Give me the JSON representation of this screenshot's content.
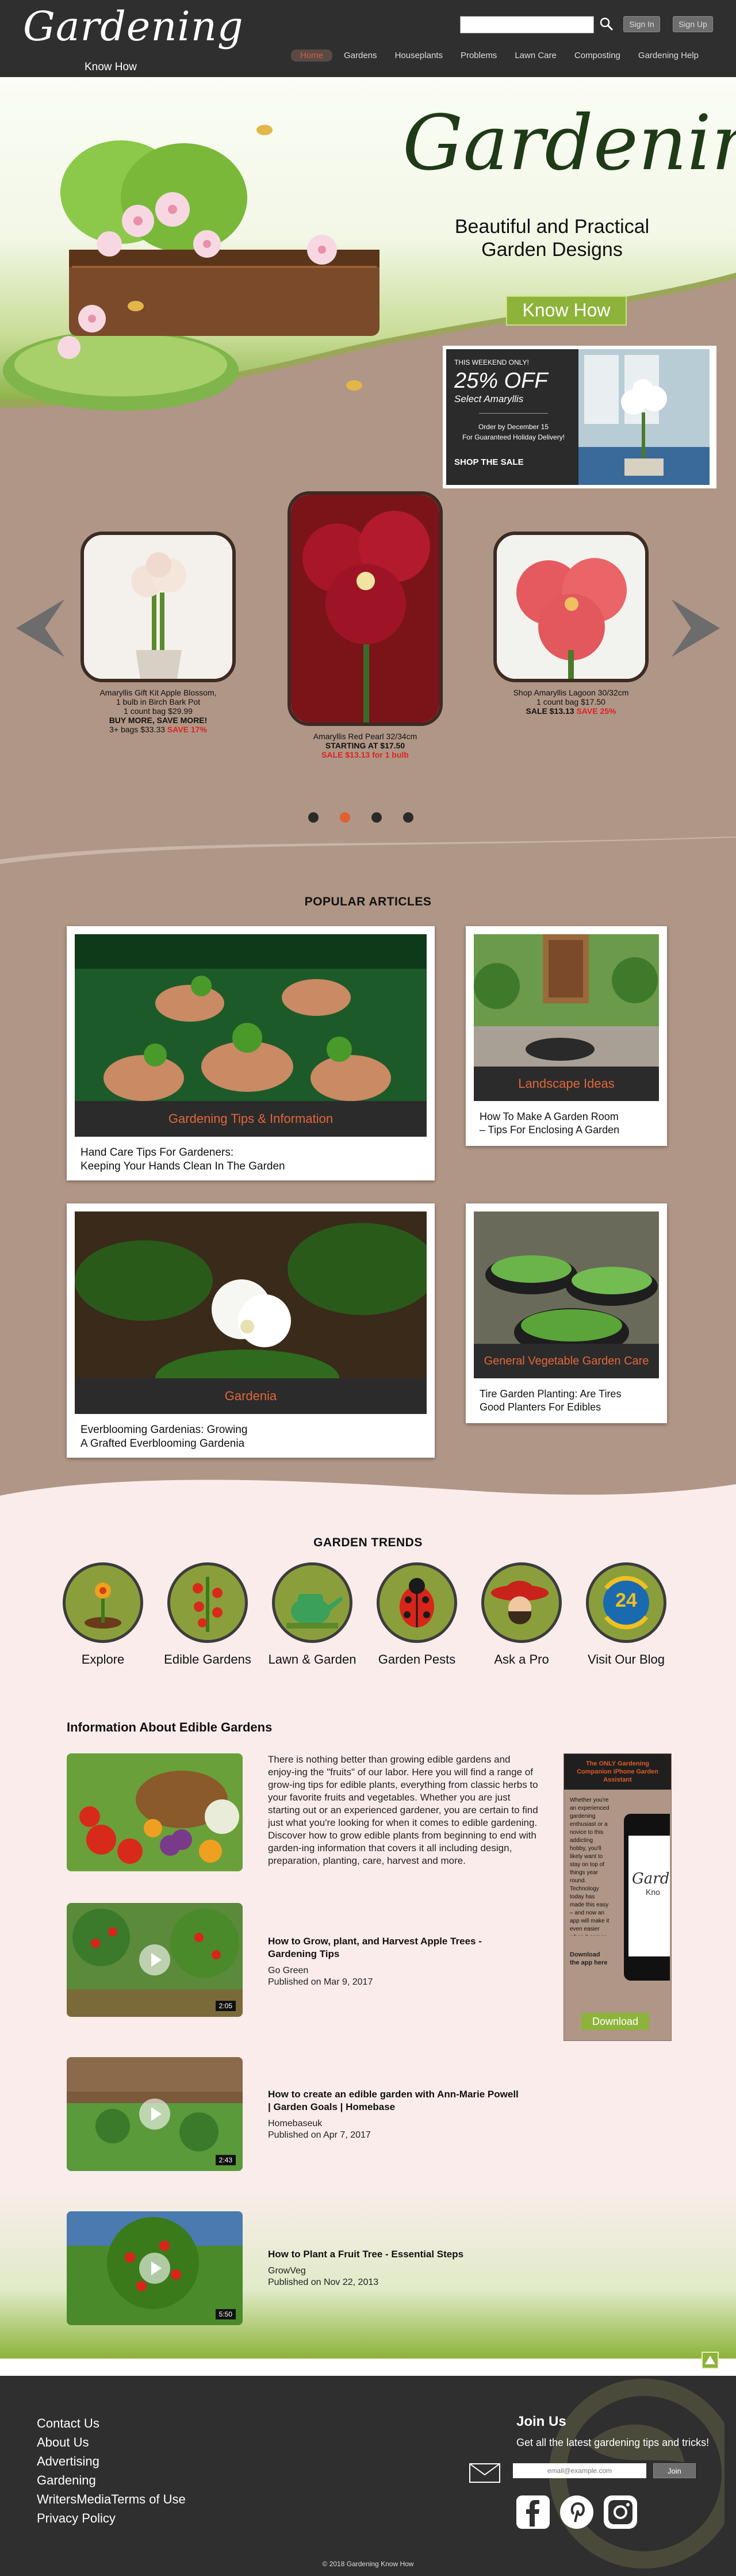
{
  "header": {
    "logo_script": "Gardening",
    "logo_sub": "Know How",
    "search_placeholder": "",
    "sign_in": "Sign In",
    "sign_up": "Sign Up",
    "nav": [
      "Home",
      "Gardens",
      "Houseplants",
      "Problems",
      "Lawn Care",
      "Composting",
      "Gardening Help"
    ]
  },
  "hero": {
    "title": "Gardening",
    "subtitle_1": "Beautiful and Practical",
    "subtitle_2": "Garden Designs",
    "button": "Know How",
    "promo": {
      "kicker": "THIS WEEKEND ONLY!",
      "percent": "25% OFF",
      "select": "Select Amaryllis",
      "order_1": "Order by December 15",
      "order_2": "For Guaranteed Holiday Delivery!",
      "cta": "SHOP THE SALE"
    }
  },
  "carousel": {
    "items": [
      {
        "l1": "Amaryllis Gift Kit Apple Blossom,",
        "l2": "1 bulb in Birch Bark Pot",
        "l3": "1 count bag  $29.99",
        "l4": "BUY MORE, SAVE MORE!",
        "l5a": "3+ bags  $33.33  ",
        "l5b": "SAVE 17%"
      },
      {
        "l1": "Amaryllis Red Pearl 32/34cm",
        "l2": "STARTING AT $17.50",
        "l3": "SALE $13.13 for 1 bulb"
      },
      {
        "l1": "Shop Amaryllis Lagoon 30/32cm",
        "l2": "1 count bag $17.50",
        "l3a": "SALE  $13.13  ",
        "l3b": "SAVE 25%"
      }
    ],
    "dots_active": 1
  },
  "articles": {
    "title": "POPULAR ARTICLES",
    "cards": [
      {
        "band": "Gardening Tips & Information",
        "cap1": "Hand Care Tips For Gardeners:",
        "cap2": "Keeping Your Hands Clean In The Garden"
      },
      {
        "band": "Landscape Ideas",
        "cap1": "How To Make A Garden Room",
        "cap2": "– Tips For Enclosing A Garden"
      },
      {
        "band": "Gardenia",
        "cap1": "Everblooming Gardenias: Growing",
        "cap2": "A Grafted Everblooming Gardenia"
      },
      {
        "band": "General Vegetable Garden Care",
        "cap1": "Tire Garden Planting: Are Tires",
        "cap2": "Good Planters For Edibles"
      }
    ]
  },
  "trends": {
    "title": "GARDEN TRENDS",
    "items": [
      "Explore",
      "Edible Gardens",
      "Lawn & Garden",
      "Garden Pests",
      "Ask a Pro",
      "Visit Our Blog"
    ],
    "blog_badge": "24"
  },
  "info": {
    "title": "Information About Edible Gardens",
    "text": "There is nothing better than growing edible gardens and enjoy-ing the \"fruits\" of our labor. Here you will find a range of grow-ing tips for edible plants, everything from classic herbs to your favorite fruits and vegetables. Whether you are just starting out or an experienced gardener, you are certain to find just what you're looking for when it comes to edible gardening. Discover how to grow edible plants from beginning to end with garden-ing information that covers it all including design, preparation, planting, care, harvest and more.",
    "ad": {
      "title": "The ONLY Gardening Companion iPhone Garden Assistant",
      "body": "Whether you're an experienced gardening enthusiast or a novice to this addicting hobby, you'll likely want to stay on top of things year round. Technology today has made this easy – and now an app will make it even easier when it comes to the garden!",
      "download_label": "Download the app here",
      "button": "Download",
      "screen_logo": "Gard",
      "screen_sub": "Kno"
    },
    "videos": [
      {
        "title": "How to Grow, plant, and Harvest Apple Trees - Gardening Tips",
        "channel": "Go Green",
        "published": "Published on Mar 9, 2017",
        "duration": "2:05"
      },
      {
        "title": "How to create an edible garden with Ann-Marie Powell | Garden Goals | Homebase",
        "channel": "Homebaseuk",
        "published": "Published on Apr 7, 2017",
        "duration": "2:43"
      },
      {
        "title": "How to Plant a Fruit Tree - Essential Steps",
        "channel": "GrowVeg",
        "published": "Published on Nov 22, 2013",
        "duration": "5:50"
      }
    ]
  },
  "footer": {
    "links": [
      "Contact Us",
      "About Us",
      "Advertising",
      "Gardening",
      "WritersMedia",
      "Terms of Use",
      "Privacy Policy"
    ],
    "join_title": "Join Us",
    "join_sub": "Get all the latest gardening tips and tricks!",
    "email_placeholder": "email@example.com",
    "join_button": "Join",
    "copyright": "© 2018 Gardening Know How"
  },
  "colors": {
    "accent": "#8db33a",
    "orange": "#e0673a",
    "dark": "#2f2f2f",
    "tan": "#b09686",
    "pink": "#fbecec"
  }
}
